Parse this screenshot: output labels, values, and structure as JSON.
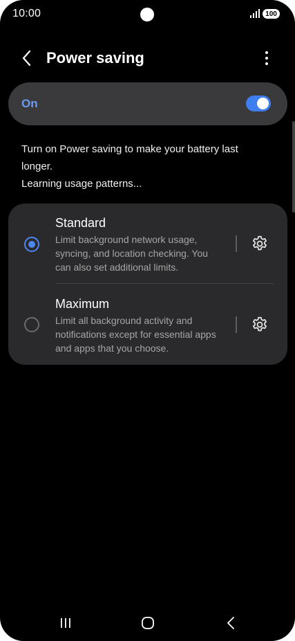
{
  "status_bar": {
    "time": "10:00",
    "battery_level": "100",
    "icons": [
      "camera-cutout",
      "signal-icon",
      "battery-icon"
    ]
  },
  "header": {
    "title": "Power saving",
    "back_icon": "chevron-left-icon",
    "more_icon": "more-vert-icon"
  },
  "master_switch": {
    "label": "On",
    "enabled": true,
    "accent_color": "#3e7ef0"
  },
  "description": "Turn on Power saving to make your battery last longer.",
  "learning_text": "Learning usage patterns...",
  "options": [
    {
      "title": "Standard",
      "description": "Limit background network usage, syncing, and location checking. You can also set additional limits.",
      "selected": true,
      "settings_icon": "gear-icon"
    },
    {
      "title": "Maximum",
      "description": "Limit all background activity and notifications except for essential apps and apps that you choose.",
      "selected": false,
      "settings_icon": "gear-icon"
    }
  ],
  "nav_bar": {
    "icons": [
      "recent-apps-icon",
      "home-icon",
      "back-icon"
    ]
  },
  "colors": {
    "background": "#000000",
    "card": "#2a2a2c",
    "switch_bar": "#3a3a3c",
    "accent": "#4c86f2",
    "secondary_text": "#a6a6a6"
  }
}
